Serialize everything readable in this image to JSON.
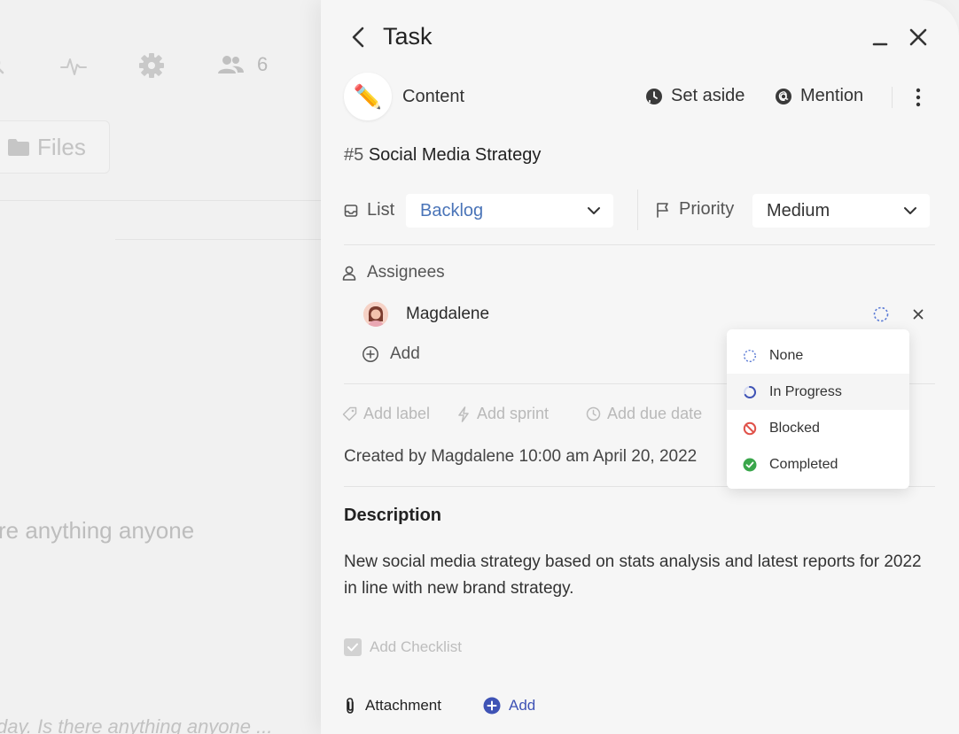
{
  "background": {
    "members_count": "6",
    "files_tab": "Files",
    "text_line_1": "re anything anyone",
    "text_line_2": "day. Is there anything anyone ..."
  },
  "panel": {
    "title": "Task",
    "content_label": "Content",
    "content_emoji": "✏️",
    "actions": {
      "set_aside": "Set aside",
      "mention": "Mention"
    },
    "task": {
      "number": "#5",
      "name": "Social Media Strategy"
    },
    "list": {
      "label": "List",
      "value": "Backlog"
    },
    "priority": {
      "label": "Priority",
      "value": "Medium"
    },
    "assignees": {
      "label": "Assignees",
      "people": [
        {
          "name": "Magdalene"
        }
      ],
      "add_label": "Add"
    },
    "meta": {
      "add_label": "Add label",
      "add_sprint": "Add sprint",
      "add_due_date": "Add due date"
    },
    "created": "Created by Magdalene 10:00 am April 20, 2022",
    "description": {
      "heading": "Description",
      "text": "New social media strategy based on stats analysis and latest reports for 2022 in line with new brand strategy."
    },
    "checklist": "Add Checklist",
    "attachment": {
      "label": "Attachment",
      "add": "Add"
    }
  },
  "status_dropdown": {
    "options": [
      {
        "label": "None",
        "icon": "dashed-circle-icon",
        "color": "#5b7bd5"
      },
      {
        "label": "In Progress",
        "icon": "progress-circle-icon",
        "color": "#3f53b5"
      },
      {
        "label": "Blocked",
        "icon": "blocked-icon",
        "color": "#e0524a"
      },
      {
        "label": "Completed",
        "icon": "check-circle-icon",
        "color": "#3aa64b"
      }
    ]
  },
  "colors": {
    "accent": "#3f53b5",
    "list_value": "#4a74b8"
  }
}
